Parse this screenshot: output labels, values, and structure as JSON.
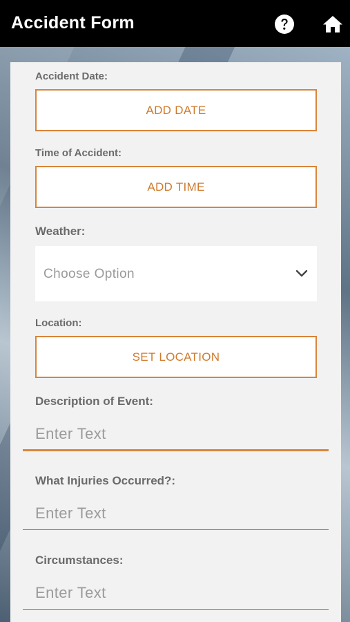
{
  "appbar": {
    "title": "Accident Form",
    "help_icon": "question-circle-icon",
    "home_icon": "home-icon"
  },
  "form": {
    "accident_date": {
      "label": "Accident Date:",
      "button": "ADD DATE"
    },
    "time_of_accident": {
      "label": "Time of Accident:",
      "button": "ADD TIME"
    },
    "weather": {
      "label": "Weather:",
      "value": "Choose Option",
      "icon": "chevron-down-icon"
    },
    "location": {
      "label": "Location:",
      "button": "SET LOCATION"
    },
    "description": {
      "label": "Description of Event:",
      "placeholder": "Enter Text"
    },
    "injuries": {
      "label": "What Injuries Occurred?:",
      "placeholder": "Enter Text"
    },
    "circumstances": {
      "label": "Circumstances:",
      "placeholder": "Enter Text"
    }
  },
  "colors": {
    "accent": "#d9843a",
    "appbar": "#000000",
    "card": "#f2f2f2"
  }
}
